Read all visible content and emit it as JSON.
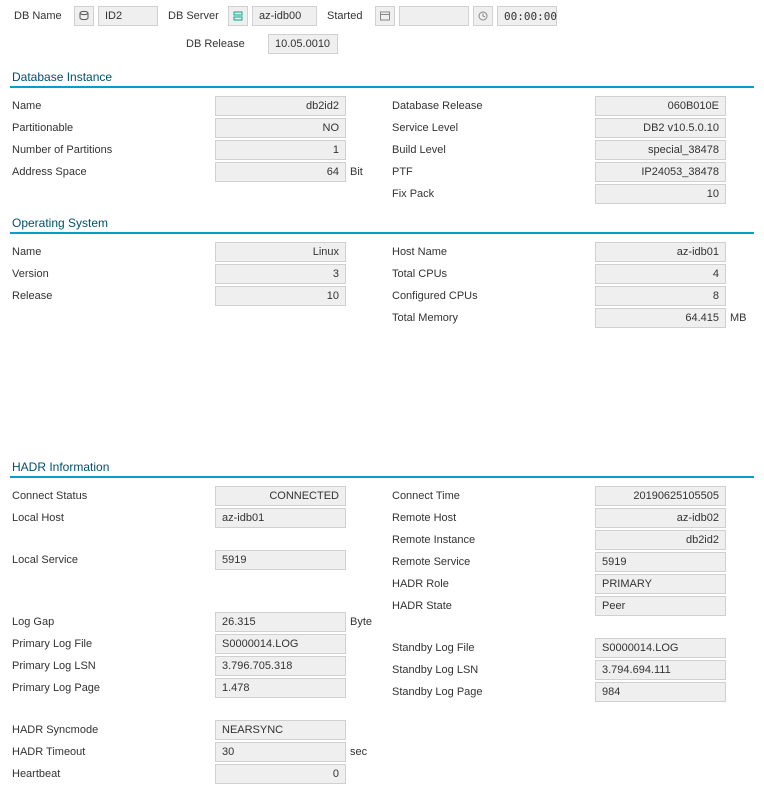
{
  "top": {
    "db_name_label": "DB Name",
    "db_name_value": "ID2",
    "db_server_label": "DB Server",
    "db_server_value": "az-idb00",
    "started_label": "Started",
    "started_date": " ",
    "started_time": "00:00:00",
    "db_release_label": "DB Release",
    "db_release_value": "10.05.0010"
  },
  "db_instance": {
    "title": "Database Instance",
    "left": {
      "name_label": "Name",
      "name_value": "db2id2",
      "part_label": "Partitionable",
      "part_value": "NO",
      "num_label": "Number of Partitions",
      "num_value": "1",
      "addr_label": "Address Space",
      "addr_value": "64",
      "addr_unit": "Bit"
    },
    "right": {
      "dbrel_label": "Database Release",
      "dbrel_value": "060B010E",
      "svl_label": "Service Level",
      "svl_value": "DB2 v10.5.0.10",
      "bld_label": "Build Level",
      "bld_value": "special_38478",
      "ptf_label": "PTF",
      "ptf_value": "IP24053_38478",
      "fix_label": "Fix Pack",
      "fix_value": "10"
    }
  },
  "os": {
    "title": "Operating System",
    "left": {
      "name_label": "Name",
      "name_value": "Linux",
      "ver_label": "Version",
      "ver_value": "3",
      "rel_label": "Release",
      "rel_value": "10"
    },
    "right": {
      "host_label": "Host Name",
      "host_value": "az-idb01",
      "tcpu_label": "Total CPUs",
      "tcpu_value": "4",
      "ccpu_label": "Configured CPUs",
      "ccpu_value": "8",
      "mem_label": "Total Memory",
      "mem_value": "64.415",
      "mem_unit": "MB"
    }
  },
  "hadr": {
    "title": "HADR Information",
    "left": {
      "cs_label": "Connect Status",
      "cs_value": "CONNECTED",
      "lh_label": "Local Host",
      "lh_value": "az-idb01",
      "ls_label": "Local Service",
      "ls_value": "5919",
      "lg_label": "Log Gap",
      "lg_value": "26.315",
      "lg_unit": "Byte",
      "plf_label": "Primary Log File",
      "plf_value": "S0000014.LOG",
      "plsn_label": "Primary Log LSN",
      "plsn_value": "3.796.705.318",
      "plp_label": "Primary Log Page",
      "plp_value": "1.478",
      "sync_label": "HADR Syncmode",
      "sync_value": "NEARSYNC",
      "to_label": "HADR Timeout",
      "to_value": "30",
      "to_unit": "sec",
      "hb_label": "Heartbeat",
      "hb_value": "0"
    },
    "right": {
      "ct_label": "Connect Time",
      "ct_value": "20190625105505",
      "rh_label": "Remote Host",
      "rh_value": "az-idb02",
      "ri_label": "Remote Instance",
      "ri_value": "db2id2",
      "rs_label": "Remote Service",
      "rs_value": "5919",
      "role_label": "HADR Role",
      "role_value": "PRIMARY",
      "state_label": "HADR State",
      "state_value": "Peer",
      "slf_label": "Standby Log File",
      "slf_value": "S0000014.LOG",
      "slsn_label": "Standby Log LSN",
      "slsn_value": "3.794.694.111",
      "slp_label": "Standby Log Page",
      "slp_value": "984"
    }
  }
}
